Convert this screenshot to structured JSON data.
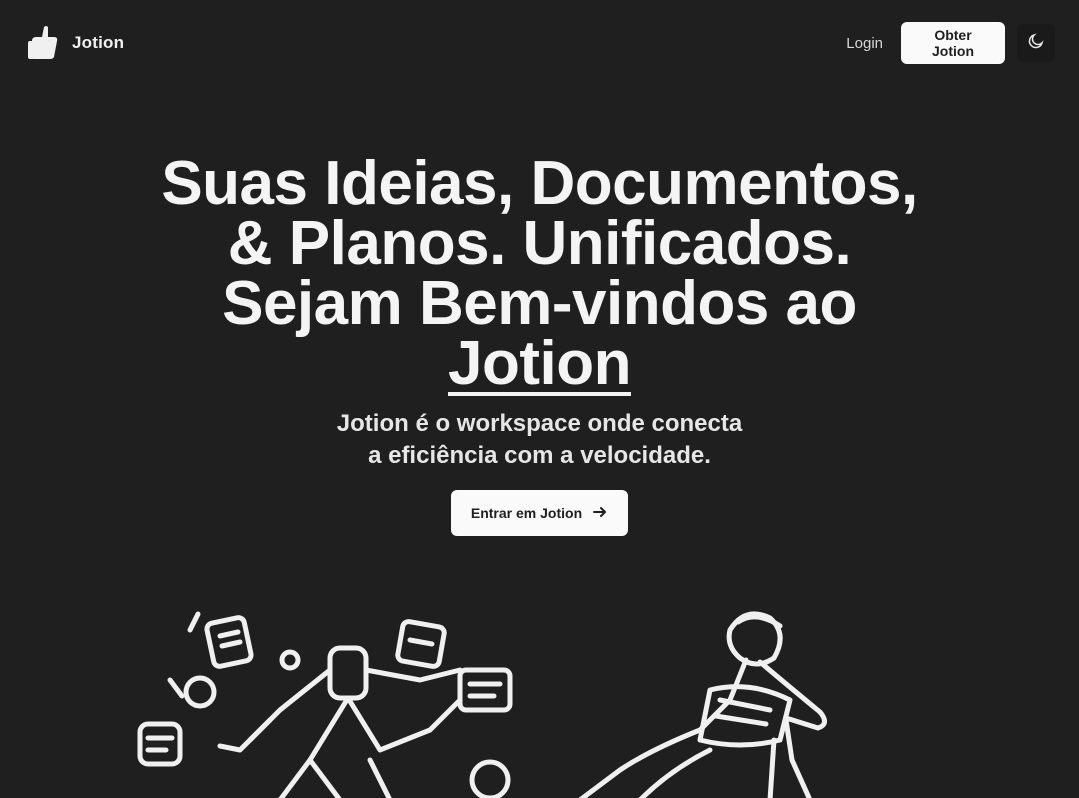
{
  "nav": {
    "brand_name": "Jotion",
    "login_label": "Login",
    "get_free_label": "Obter Jotion",
    "theme_icon": "moon-icon"
  },
  "hero": {
    "headline_line1": "Suas Ideias, Documentos,",
    "headline_line2": "& Planos. Unificados.",
    "headline_line3": "Sejam Bem-vindos ao",
    "headline_brand": "Jotion",
    "subtitle_line1": "Jotion é o workspace onde conecta",
    "subtitle_line2": "a eficiência com a velocidade.",
    "cta_label": "Entrar em Jotion",
    "cta_icon": "arrow-right-icon"
  },
  "illustrations": {
    "left": "documents-illustration",
    "right": "reading-illustration"
  }
}
